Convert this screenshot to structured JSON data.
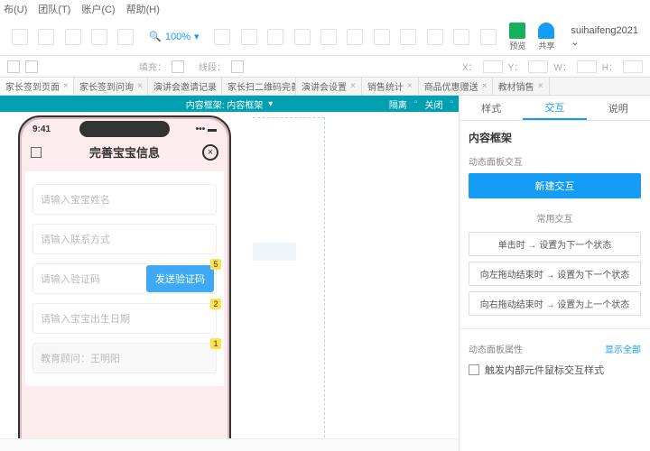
{
  "menu": {
    "items": [
      "布(U)",
      "团队(T)",
      "账户(C)",
      "帮助(H)"
    ]
  },
  "zoom": "100%",
  "actions": {
    "preview": "预览",
    "share": "共享"
  },
  "user": "suihaifeng2021",
  "propbar": {
    "fill": "填充：",
    "line": "线段：",
    "x": "X：",
    "y": "Y：",
    "w": "W：",
    "h": "H："
  },
  "tabs": [
    "家长签到页面",
    "家长签到问询",
    "演讲会邀请记录",
    "家长扫二维码完善信息",
    "演讲会设置",
    "销售统计",
    "商品优惠赠送",
    "教材销售"
  ],
  "selection": {
    "label": "内容框架: 内容框架",
    "isolate": "隔离",
    "close": "关闭"
  },
  "phone": {
    "time": "9:41",
    "title": "完善宝宝信息",
    "fields": {
      "name": "请输入宝宝姓名",
      "contact": "请输入联系方式",
      "code": "请输入验证码",
      "send": "发送验证码",
      "birthday": "请输入宝宝出生日期",
      "advisor": "教育顾问：王明阳"
    },
    "badges": {
      "code": "5",
      "birthday": "2",
      "advisor": "1"
    }
  },
  "panel": {
    "tabs": [
      "样式",
      "交互",
      "说明"
    ],
    "title": "内容框架",
    "sub": "动态面板交互",
    "new": "新建交互",
    "section1": "常用交互",
    "presets": [
      "单击时 → 设置为下一个状态",
      "向左拖动结束时 → 设置为下一个状态",
      "向右拖动结束时 → 设置为上一个状态"
    ],
    "section2": "动态面板属性",
    "showall": "显示全部",
    "checkbox": "触发内部元件鼠标交互样式"
  }
}
